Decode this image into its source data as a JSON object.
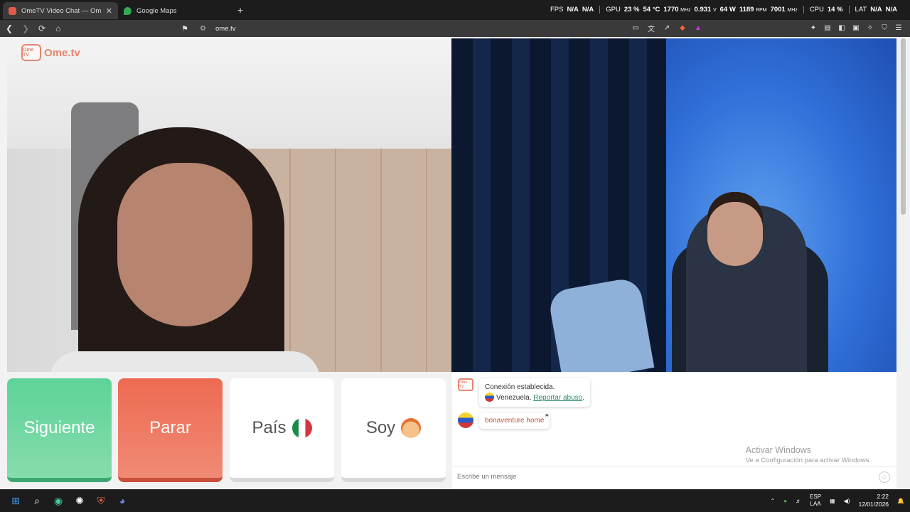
{
  "browser": {
    "tabs": [
      {
        "title": "OmeTV Video Chat — Omeg",
        "active": true,
        "fav_color": "#e05a47"
      },
      {
        "title": "Google Maps",
        "active": false,
        "fav_color": "#34a853"
      }
    ],
    "url": "ome.tv"
  },
  "overlay": {
    "fps_label": "FPS",
    "fps_val1": "N/A",
    "fps_val2": "N/A",
    "gpu_label": "GPU",
    "gpu_usage": "23 %",
    "gpu_temp": "54 °C",
    "gpu_clock": "1770",
    "gpu_clock_unit": "MHz",
    "gpu_volt": "0.931",
    "gpu_volt_unit": "V",
    "gpu_power": "64 W",
    "gpu_fan": "1189",
    "gpu_fan_unit": "RPM",
    "gpu_mem": "7001",
    "gpu_mem_unit": "MHz",
    "cpu_label": "CPU",
    "cpu_usage": "14 %",
    "lat_label": "LAT",
    "lat_val1": "N/A",
    "lat_val2": "N/A"
  },
  "site": {
    "logo_text": "Ome.tv",
    "logo_badge": "Ome TV",
    "buttons": {
      "next": "Siguiente",
      "stop": "Parar",
      "country": "País",
      "gender": "Soy"
    }
  },
  "chat": {
    "system_msg": "Conexión establecida.",
    "country": "Venezuela.",
    "report": "Reportar abuso",
    "period": ".",
    "user_msg": "bonaventure home",
    "input_placeholder": "Escribe un mensaje",
    "watermark_title": "Activar Windows",
    "watermark_sub": "Ve a Configuración para activar Windows."
  },
  "taskbar": {
    "lang1": "ESP",
    "lang2": "LAA",
    "time": "2:22",
    "date": "12/01/2026"
  }
}
